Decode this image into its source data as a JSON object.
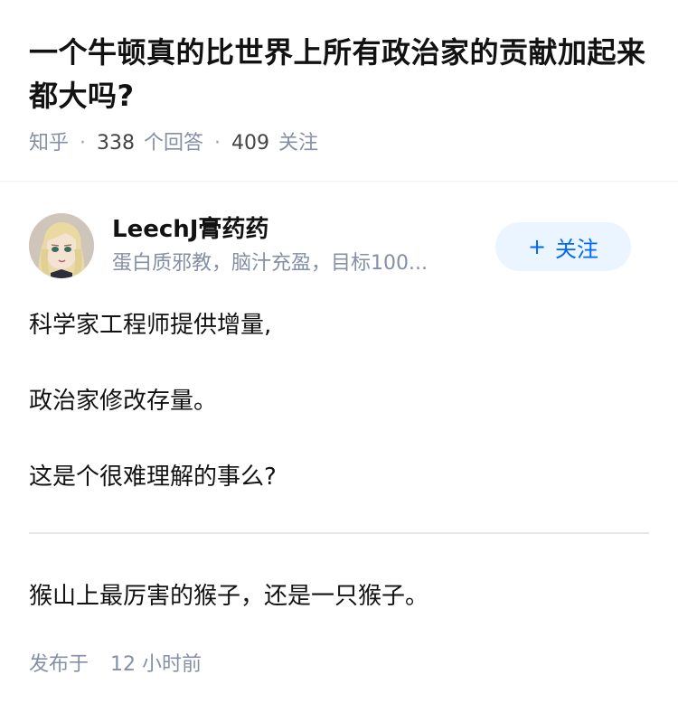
{
  "question": {
    "title": "一个牛顿真的比世界上所有政治家的贡献加起来都大吗?",
    "source": "知乎",
    "separator": "·",
    "answer_count": "338",
    "answer_label": "个回答",
    "follower_count": "409",
    "follower_label": "关注"
  },
  "author": {
    "name": "LeechJ膏药药",
    "bio": "蛋白质邪教，脑汁充盈，目标100...",
    "avatar_icon": "anime-avatar-icon",
    "follow_plus": "+",
    "follow_label": "关注"
  },
  "answer": {
    "paragraphs": [
      "科学家工程师提供增量,",
      "政治家修改存量。",
      "这是个很难理解的事么?",
      "猴山上最厉害的猴子，还是一只猴子。"
    ],
    "published_prefix": "发布于",
    "published_time": "12 小时前"
  },
  "colors": {
    "accent": "#0066ff",
    "follow_bg": "#ebf5ff",
    "meta_text": "#8590a6",
    "body_text": "#121212"
  }
}
